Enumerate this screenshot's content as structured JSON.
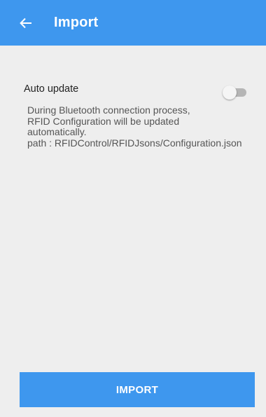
{
  "app_bar": {
    "title": "Import",
    "back_icon": "arrow-back-icon",
    "background": "#3e97ee"
  },
  "auto_update": {
    "label": "Auto update",
    "enabled": false,
    "description": {
      "line1": "During Bluetooth connection process,",
      "line2": "RFID Configuration will be updated",
      "line3": "automatically.",
      "line4": "path : RFIDControl/RFIDJsons/Configuration.json"
    }
  },
  "actions": {
    "import_label": "IMPORT"
  },
  "colors": {
    "accent": "#3e97ee",
    "page_background": "#eeeeee"
  }
}
